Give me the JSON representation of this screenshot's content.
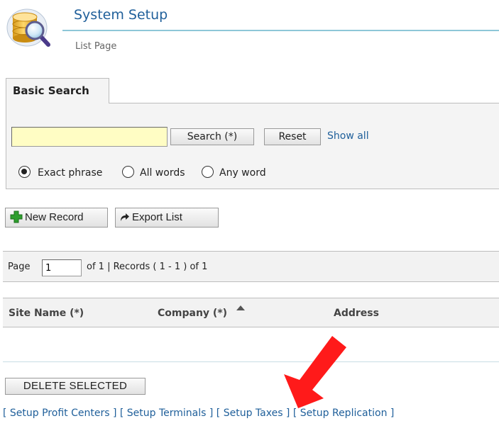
{
  "header": {
    "title": "System Setup",
    "subtitle": "List Page"
  },
  "search": {
    "tab_label": "Basic Search",
    "input_value": "",
    "search_button": "Search (*)",
    "reset_button": "Reset",
    "show_all": "Show all",
    "options": [
      {
        "label": "Exact phrase",
        "checked": true
      },
      {
        "label": "All words",
        "checked": false
      },
      {
        "label": "Any word",
        "checked": false
      }
    ]
  },
  "toolbar": {
    "new_record": "New Record",
    "export_list": "Export List"
  },
  "pager": {
    "page_label": "Page",
    "page_value": "1",
    "summary": "of  1 | Records ( 1 - 1 ) of 1"
  },
  "grid": {
    "columns": [
      "Site Name (*)",
      "Company (*)",
      "Address"
    ]
  },
  "actions": {
    "delete_selected": "DELETE SELECTED"
  },
  "links": [
    "[ Setup Profit Centers ]",
    "[ Setup Terminals ]",
    "[ Setup Taxes ]",
    "[ Setup Replication ]"
  ],
  "colors": {
    "link": "#1f5f9a",
    "input_highlight": "#fffdc4",
    "new_icon": "#2e9e2e",
    "annotation_arrow": "#ff1a1a"
  },
  "icons": {
    "app": "database-search-icon",
    "new": "plus-icon",
    "export": "export-arrow-icon",
    "sort": "sort-ascending-icon"
  }
}
